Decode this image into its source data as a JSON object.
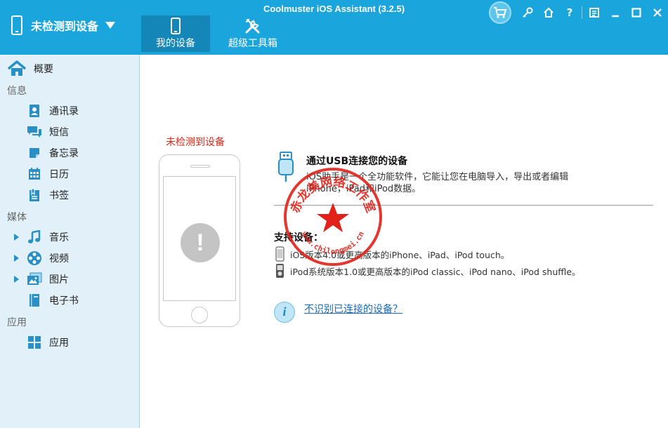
{
  "app": {
    "title": "Coolmuster iOS Assistant (3.2.5)"
  },
  "device_selector": {
    "label": "未检测到设备"
  },
  "tabs": [
    {
      "label": "我的设备",
      "active": true
    },
    {
      "label": "超级工具箱",
      "active": false
    }
  ],
  "toolbar_icons": [
    "cart-icon",
    "key-icon",
    "home-icon",
    "help-icon",
    "feedback-icon",
    "minimize-icon",
    "maximize-icon",
    "close-icon"
  ],
  "toolbar": {
    "help_label": "?"
  },
  "sidebar": {
    "home_label": "概要",
    "sections": [
      {
        "title": "信息",
        "items": [
          {
            "label": "通讯录",
            "icon": "contacts-icon"
          },
          {
            "label": "短信",
            "icon": "messages-icon"
          },
          {
            "label": "备忘录",
            "icon": "notes-icon"
          },
          {
            "label": "日历",
            "icon": "calendar-icon"
          },
          {
            "label": "书签",
            "icon": "bookmarks-icon"
          }
        ]
      },
      {
        "title": "媒体",
        "items": [
          {
            "label": "音乐",
            "icon": "music-icon",
            "expandable": true
          },
          {
            "label": "视频",
            "icon": "video-icon",
            "expandable": true
          },
          {
            "label": "图片",
            "icon": "photos-icon",
            "expandable": true
          },
          {
            "label": "电子书",
            "icon": "ebook-icon"
          }
        ]
      },
      {
        "title": "应用",
        "items": [
          {
            "label": "应用",
            "icon": "apps-icon"
          }
        ]
      }
    ]
  },
  "main": {
    "status": "未检测到设备",
    "alert_symbol": "!",
    "connect_title": "通过USB连接您的设备",
    "connect_desc_1": "iOS助手是一个全功能软件，它能让您在电脑导入，导出或者编辑",
    "connect_desc_2": "iPhone，iPad和iPod数据。",
    "supported_title": "支持设备：",
    "supported_ios": "iOS版本4.0或更高版本的iPhone、iPad、iPod touch。",
    "supported_ipod": "iPod系统版本1.0或更高版本的iPod classic、iPod nano、iPod shuffle。",
    "help_symbol": "i",
    "help_link": "不识别已连接的设备？"
  },
  "watermark": {
    "text": "赤龙美网络工作室",
    "url": "www.chilongmei.cn"
  },
  "colors": {
    "topbar": "#1aa6dc",
    "tab_active": "#1586b8",
    "sidebar_bg": "#e2f1f9",
    "icon_blue": "#2a8fc4",
    "status_red": "#d02b1a",
    "link": "#1a6bbd",
    "stamp_red": "#e0221a"
  }
}
